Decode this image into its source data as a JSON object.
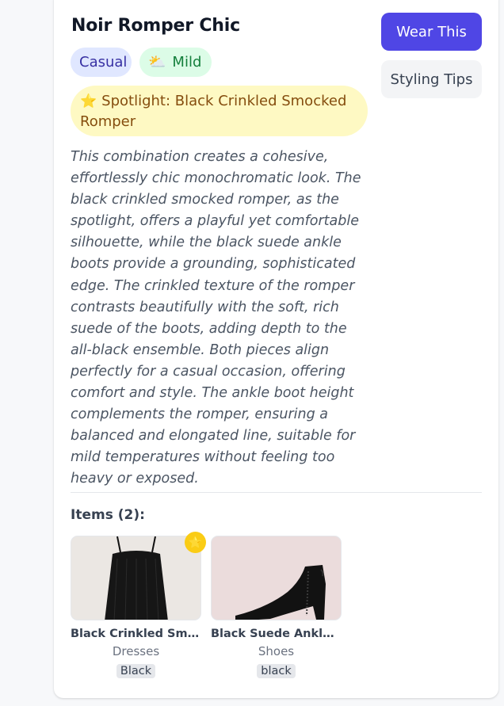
{
  "outfit": {
    "title": "Noir Romper Chic",
    "occasion_tag": "Casual",
    "weather_icon": "sun-behind-cloud-icon",
    "weather_tag": "Mild",
    "spotlight_icon": "star-icon",
    "spotlight_text": "Spotlight: Black Crinkled Smocked Romper",
    "description": "This combination creates a cohesive, effortlessly chic monochromatic look. The black crinkled smocked romper, as the spotlight, offers a playful yet comfortable silhouette, while the black suede ankle boots provide a grounding, sophisticated edge. The crinkled texture of the romper contrasts beautifully with the soft, rich suede of the boots, adding depth to the all-black ensemble. Both pieces align perfectly for a casual occasion, offering comfort and style. The ankle boot height complements the romper, ensuring a balanced and elongated line, suitable for mild temperatures without feeling too heavy or exposed."
  },
  "actions": {
    "wear_label": "Wear This",
    "tips_label": "Styling Tips"
  },
  "items_section": {
    "heading": "Items (2):",
    "items": [
      {
        "name": "Black Crinkled Smocked Romper",
        "category": "Dresses",
        "color": "Black",
        "spotlight": true
      },
      {
        "name": "Black Suede Ankle Boots",
        "category": "Shoes",
        "color": "black",
        "spotlight": false
      }
    ]
  },
  "colors": {
    "primary": "#4f46e5",
    "occasion_bg": "#e0e7ff",
    "weather_bg": "#dcfce7",
    "spotlight_bg": "#fef9c3",
    "spotlight_badge": "#facc15"
  }
}
